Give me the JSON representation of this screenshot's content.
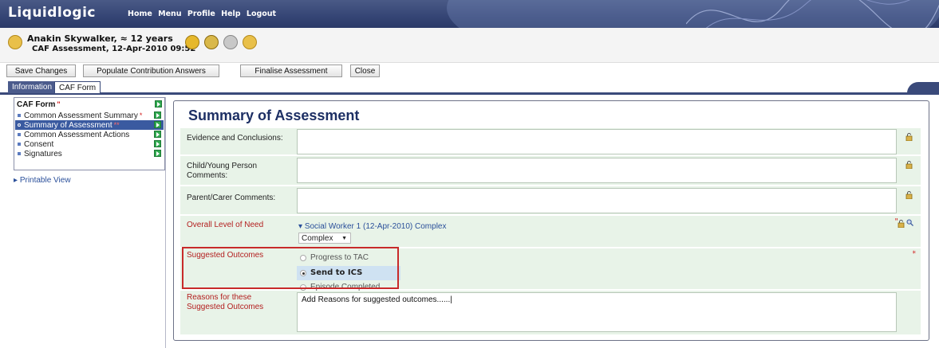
{
  "app": {
    "logo": "Liquidlogic",
    "nav": [
      "Home",
      "Menu",
      "Profile",
      "Help",
      "Logout"
    ]
  },
  "patient": {
    "name": "Anakin Skywalker, ≈ 12 years",
    "subtitle": "CAF Assessment, 12-Apr-2010 09:52"
  },
  "toolbar": {
    "save": "Save Changes",
    "populate": "Populate Contribution Answers",
    "finalise": "Finalise Assessment",
    "close": "Close"
  },
  "tabs": {
    "information": "Information",
    "caf_form": "CAF Form"
  },
  "sidebar": {
    "title": "CAF Form",
    "items": [
      {
        "label": "Common Assessment Summary",
        "req": "*"
      },
      {
        "label": "Summary of Assessment",
        "req": "**"
      },
      {
        "label": "Common Assessment Actions",
        "req": ""
      },
      {
        "label": "Consent",
        "req": ""
      },
      {
        "label": "Signatures",
        "req": ""
      }
    ],
    "printable": "Printable View"
  },
  "form": {
    "title": "Summary of Assessment",
    "evidence_label": "Evidence and Conclusions:",
    "child_label": "Child/Young Person Comments:",
    "parent_label": "Parent/Carer Comments:",
    "need_label": "Overall Level of Need",
    "need_link": "Social Worker 1 (12-Apr-2010) Complex",
    "need_value": "Complex",
    "outcomes_label": "Suggested Outcomes",
    "outcomes": [
      "Progress to TAC",
      "Send to ICS",
      "Episode Completed"
    ],
    "reasons_label": "Reasons for these Suggested Outcomes",
    "reasons_value": "Add Reasons for suggested outcomes......|"
  },
  "colors": {
    "banner": "#364676",
    "row_bg": "#e8f3e8",
    "selected": "#3a5aa0",
    "highlight_border": "#c82a2a"
  }
}
